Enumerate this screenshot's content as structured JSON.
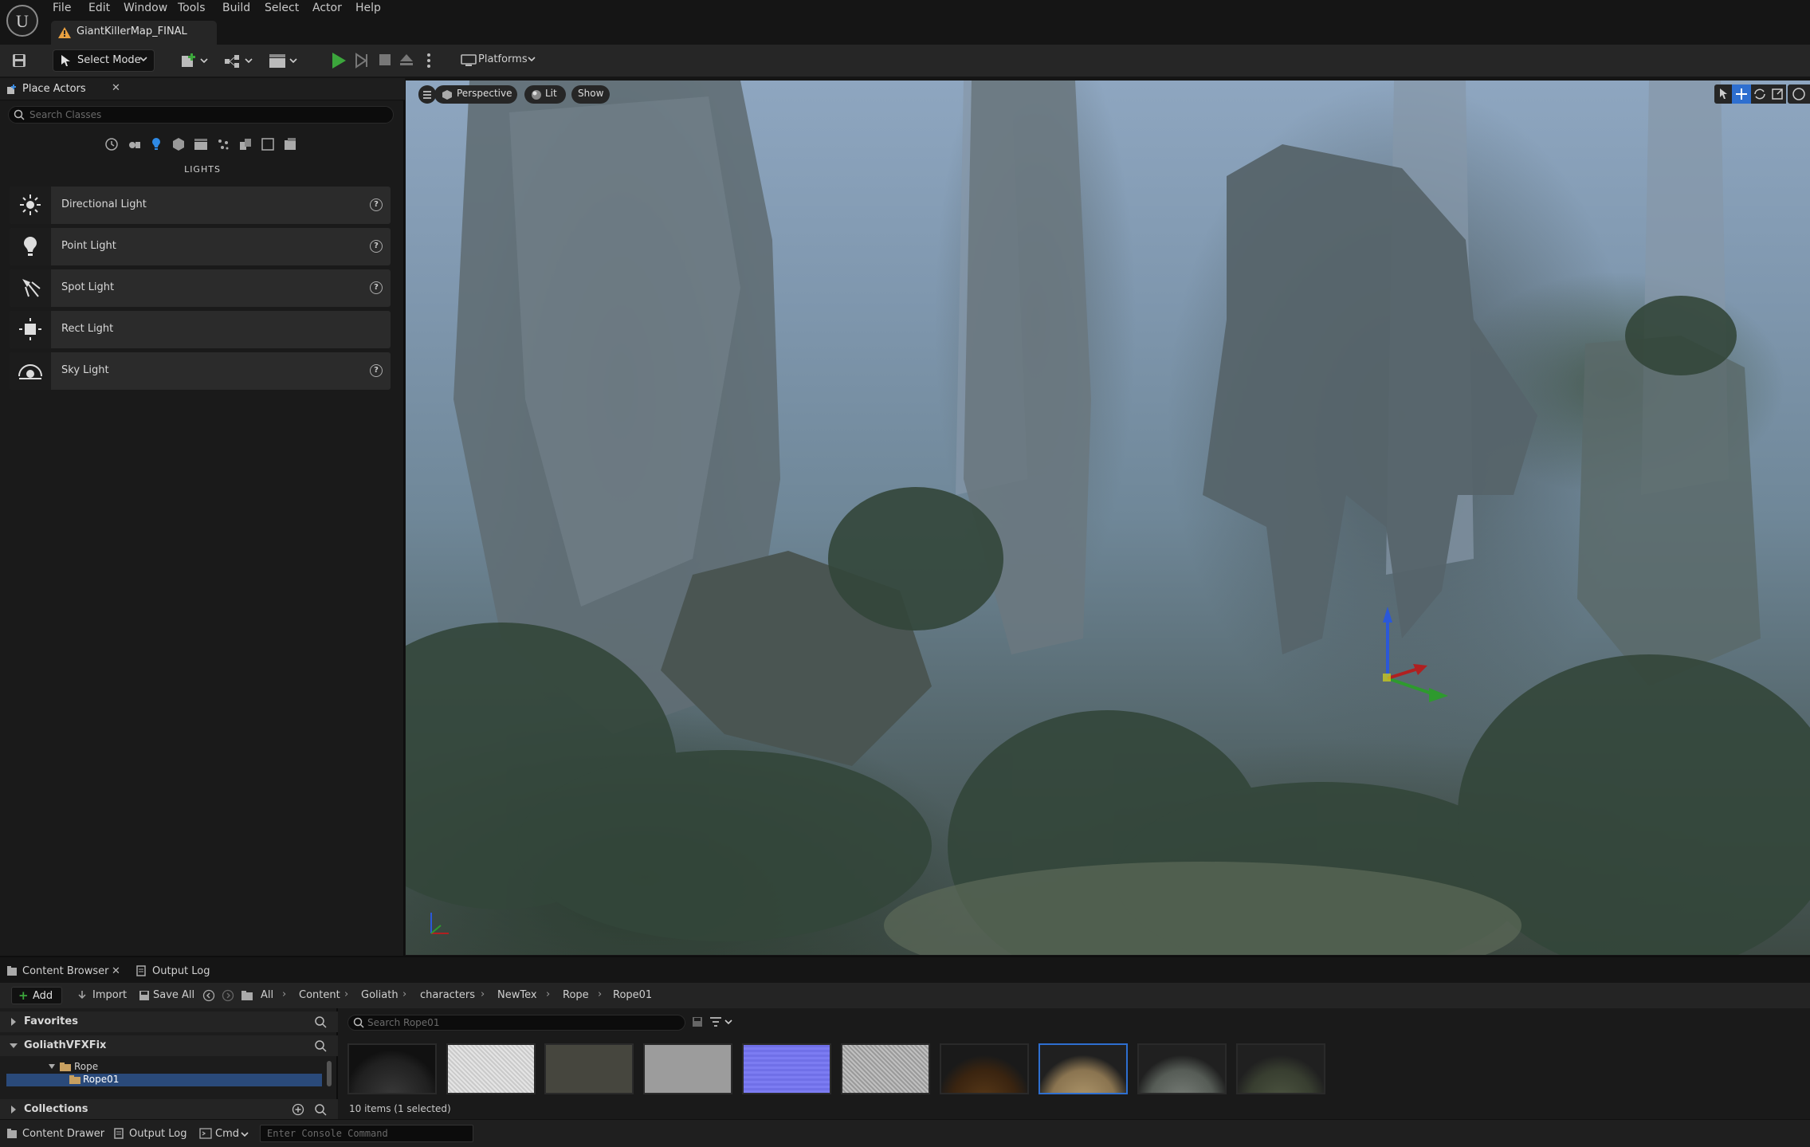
{
  "menu": {
    "items": [
      "File",
      "Edit",
      "Window",
      "Tools",
      "Build",
      "Select",
      "Actor",
      "Help"
    ]
  },
  "level_tab": {
    "title": "GiantKillerMap_FINAL"
  },
  "toolbar": {
    "select_mode": "Select Mode",
    "platforms": "Platforms"
  },
  "place_actors": {
    "tab_label": "Place Actors",
    "search_placeholder": "Search Classes",
    "category_header": "LIGHTS",
    "items": [
      {
        "label": "Directional Light",
        "icon": "directional-light-icon",
        "help": true
      },
      {
        "label": "Point Light",
        "icon": "point-light-icon",
        "help": true
      },
      {
        "label": "Spot Light",
        "icon": "spot-light-icon",
        "help": true
      },
      {
        "label": "Rect Light",
        "icon": "rect-light-icon",
        "help": false
      },
      {
        "label": "Sky Light",
        "icon": "sky-light-icon",
        "help": true
      }
    ]
  },
  "viewport": {
    "view_mode": "Perspective",
    "lighting": "Lit",
    "show": "Show"
  },
  "content_browser": {
    "tabs": [
      "Content Browser",
      "Output Log"
    ],
    "toolbar": {
      "add": "Add",
      "import": "Import",
      "save_all": "Save All"
    },
    "breadcrumbs": [
      "All",
      "Content",
      "Goliath",
      "characters",
      "NewTex",
      "Rope",
      "Rope01"
    ],
    "favorites": "Favorites",
    "project": "GoliathVFXFix",
    "tree": [
      {
        "label": "Rope",
        "level": 1
      },
      {
        "label": "Rope01",
        "level": 2,
        "selected": true
      }
    ],
    "collections": "Collections",
    "search_placeholder": "Search Rope01",
    "item_count": "10 items (1 selected)",
    "thumbnails": [
      {
        "name": "dark-sphere",
        "color": "#2a2a2a"
      },
      {
        "name": "white-noise",
        "color": "#d8d8d8"
      },
      {
        "name": "dark-olive",
        "color": "#4a4a42"
      },
      {
        "name": "grey",
        "color": "#9a9a9a"
      },
      {
        "name": "normal-blue",
        "color": "#7a7af0"
      },
      {
        "name": "grey-noise",
        "color": "#b8b8b8"
      },
      {
        "name": "brown-sphere",
        "color": "#3a2410"
      },
      {
        "name": "rope-sphere",
        "color": "#9c8560",
        "selected": true
      },
      {
        "name": "grey-sphere",
        "color": "#5a5f5a"
      },
      {
        "name": "olive-sphere",
        "color": "#3c4232"
      }
    ]
  },
  "statusbar": {
    "content_drawer": "Content Drawer",
    "output_log": "Output Log",
    "cmd": "Cmd",
    "console_placeholder": "Enter Console Command"
  },
  "colors": {
    "accent_blue": "#2e6fd0",
    "play_green": "#3ca63c",
    "selection": "#2a4a7a"
  }
}
